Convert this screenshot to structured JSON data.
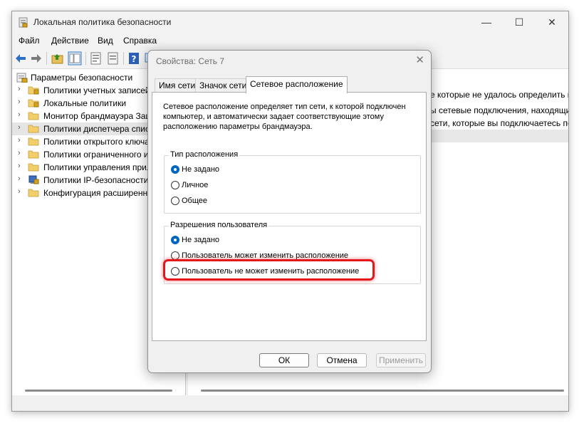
{
  "window": {
    "title": "Локальная политика безопасности",
    "controls": {
      "minimize": "—",
      "maximize": "☐",
      "close": "✕"
    }
  },
  "menu": [
    "Файл",
    "Действие",
    "Вид",
    "Справка"
  ],
  "tree": {
    "root": "Параметры безопасности",
    "items": [
      {
        "label": "Политики учетных записей",
        "icon": "folder-lock-icon"
      },
      {
        "label": "Локальные политики",
        "icon": "folder-lock-icon"
      },
      {
        "label": "Монитор брандмауэра Защитника Windows",
        "icon": "folder-icon"
      },
      {
        "label": "Политики диспетчера списка сетей",
        "icon": "folder-icon",
        "selected": true
      },
      {
        "label": "Политики открытого ключа",
        "icon": "folder-icon"
      },
      {
        "label": "Политики ограниченного использования программ",
        "icon": "folder-icon"
      },
      {
        "label": "Политики управления приложениями",
        "icon": "folder-icon"
      },
      {
        "label": "Политики IP-безопасности на \"Локальный компьютер\"",
        "icon": "network-policy-icon"
      },
      {
        "label": "Конфигурация расширенной политики аудита",
        "icon": "folder-icon"
      }
    ]
  },
  "right_pane": {
    "lines": [
      "е которые не удалось определить из-за ошибок сети или отсу",
      "ы сетевые подключения, находящихся в процессе идентиф",
      "сети, которые вы подключаетесь пользователь."
    ]
  },
  "dialog": {
    "title": "Свойства: Сеть 7",
    "close": "✕",
    "tabs": [
      "Имя сети",
      "Значок сети",
      "Сетевое расположение"
    ],
    "description": "Сетевое расположение определяет тип сети, к которой подключен компьютер, и автоматически задает соответствующие этому расположению параметры брандмауэра.",
    "location_group": {
      "title": "Тип расположения",
      "options": [
        "Не задано",
        "Личное",
        "Общее"
      ],
      "selected": 0
    },
    "permissions_group": {
      "title": "Разрешения пользователя",
      "options": [
        "Не задано",
        "Пользователь может изменить расположение",
        "Пользователь не может изменить расположение"
      ],
      "selected": 0
    },
    "buttons": {
      "ok": "ОК",
      "cancel": "Отмена",
      "apply": "Применить"
    }
  },
  "colors": {
    "accent": "#0067c0",
    "highlight": "#e4171b"
  }
}
